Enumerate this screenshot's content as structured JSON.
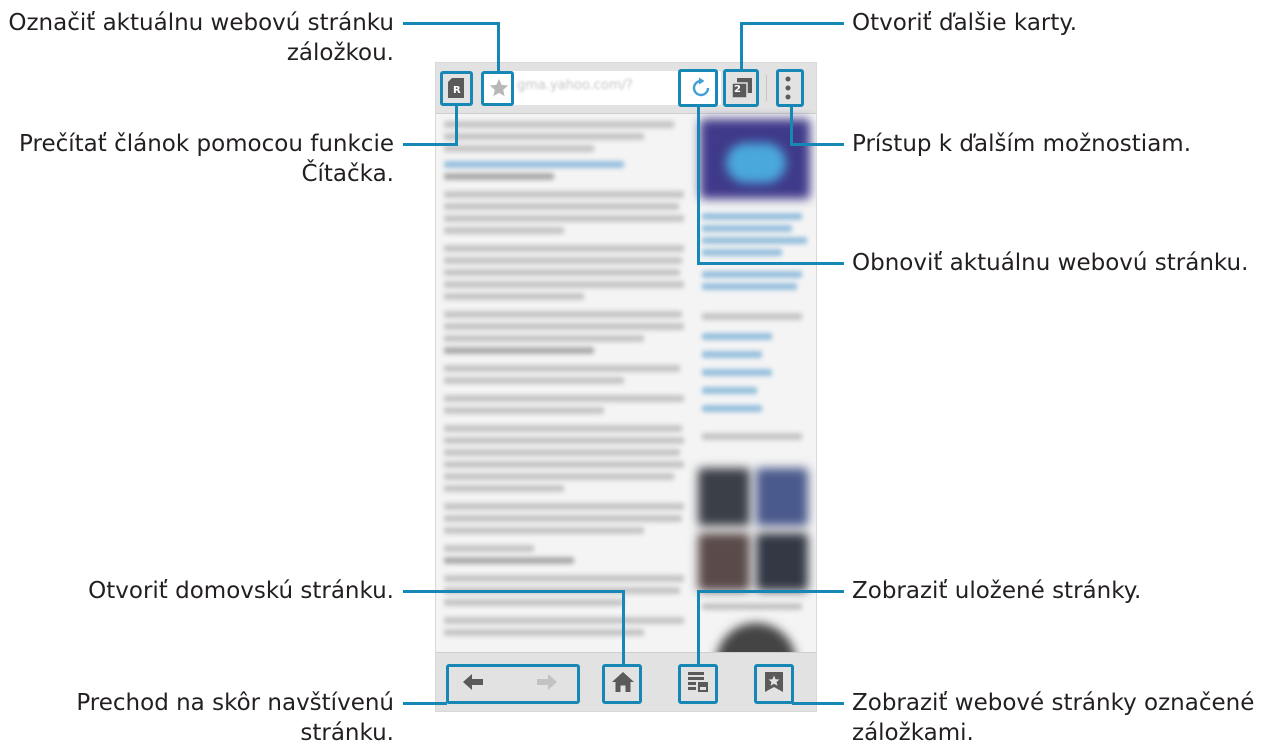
{
  "annotations": {
    "bookmark_page": [
      "Označiť aktuálnu webovú stránku",
      "záložkou."
    ],
    "reader": [
      "Prečítať článok pomocou funkcie",
      "Čítačka."
    ],
    "home": [
      "Otvoriť domovskú stránku."
    ],
    "back_forward": [
      "Prechod na skôr navštívenú",
      "stránku."
    ],
    "tabs": [
      "Otvoriť ďalšie karty."
    ],
    "more_options": [
      "Prístup k ďalším možnostiam."
    ],
    "refresh": [
      "Obnoviť aktuálnu webovú stránku."
    ],
    "saved_pages": [
      "Zobraziť uložené stránky."
    ],
    "bookmarks": [
      "Zobraziť webové stránky označené",
      "záložkami."
    ]
  },
  "browser": {
    "url": "gma.yahoo.com/?",
    "tab_count": "2",
    "reader_badge": "R"
  },
  "colors": {
    "callout": "#1787b5",
    "toolbar": "#e2e2e2",
    "icon": "#5a5a5a",
    "refresh": "#3f9fd6"
  }
}
